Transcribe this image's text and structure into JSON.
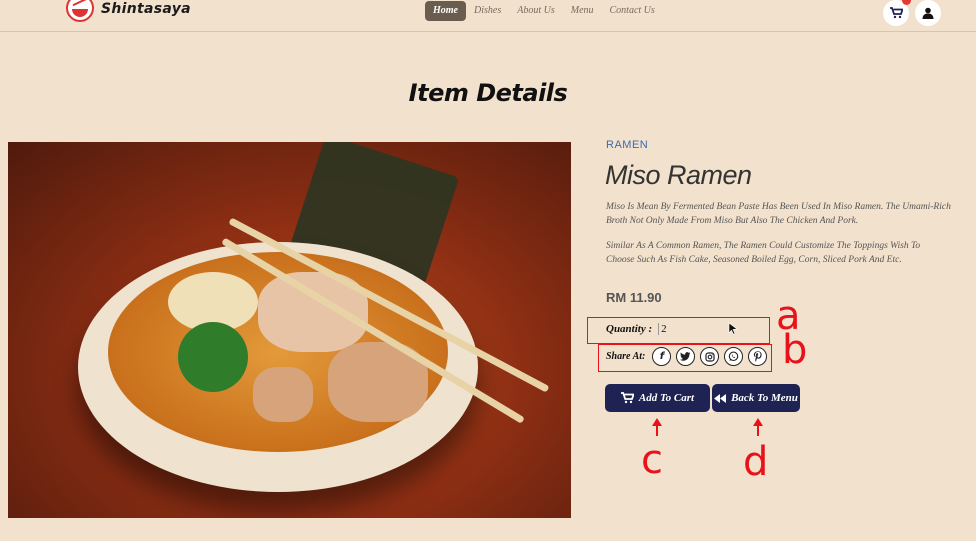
{
  "header": {
    "brand": "Shintasaya",
    "nav": [
      "Home",
      "Dishes",
      "About Us",
      "Menu",
      "Contact Us"
    ],
    "active_nav": "Home",
    "icons": [
      "cart-icon",
      "user-icon"
    ]
  },
  "page_title": "Item Details",
  "item": {
    "category": "RAMEN",
    "name": "Miso Ramen",
    "description_1": "Miso Is Mean By Fermented Bean Paste Has Been Used In Miso Ramen. The Umami-Rich Broth Not Only Made From Miso But Also The Chicken And Pork.",
    "description_2": "Similar As A Common Ramen, The Ramen Could Customize The Toppings Wish To Choose Such As Fish Cake, Seasoned Boiled Egg, Corn, Sliced Pork And Etc.",
    "price": "RM 11.90",
    "quantity_label": "Quantity :",
    "quantity_value": "2",
    "share_label": "Share At:",
    "share_icons": [
      "facebook-icon",
      "twitter-icon",
      "instagram-icon",
      "whatsapp-icon",
      "pinterest-icon"
    ]
  },
  "buttons": {
    "add_to_cart": "Add To Cart",
    "back_to_menu": "Back To Menu"
  },
  "annotations": [
    "a",
    "b",
    "c",
    "d"
  ],
  "colors": {
    "background": "#f2e1cc",
    "button": "#1e2354",
    "category": "#3a6bb0",
    "annotation": "#e8121a",
    "active_nav": "#6a5d50"
  }
}
